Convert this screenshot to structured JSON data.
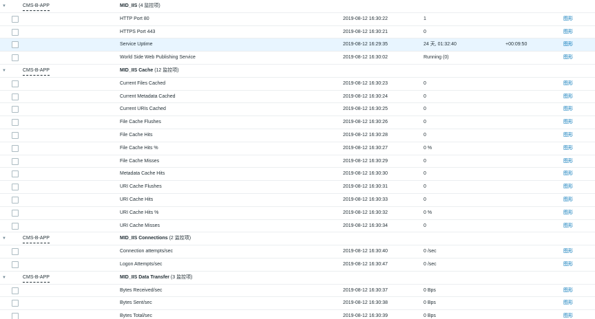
{
  "graph_link_label": "图形",
  "groups": [
    {
      "host": "CMS-B-APP",
      "app": "MID_IIS",
      "count": "(4 监控项)",
      "items": [
        {
          "name": "HTTP Port 80",
          "time": "2019-08-12 16:30:22",
          "value": "1",
          "change": ""
        },
        {
          "name": "HTTPS Port 443",
          "time": "2019-08-12 16:30:21",
          "value": "0",
          "change": ""
        },
        {
          "name": "Service Uptime",
          "time": "2019-08-12 16:29:35",
          "value": "24 天, 01:32:40",
          "change": "+00:09:50"
        },
        {
          "name": "World Side Web Publishing Service",
          "time": "2019-08-12 16:30:02",
          "value": "Running (0)",
          "change": ""
        }
      ]
    },
    {
      "host": "CMS-B-APP",
      "app": "MID_IIS Cache",
      "count": "(12 监控项)",
      "items": [
        {
          "name": "Current Files Cached",
          "time": "2019-08-12 16:30:23",
          "value": "0",
          "change": ""
        },
        {
          "name": "Current Metadata Cached",
          "time": "2019-08-12 16:30:24",
          "value": "0",
          "change": ""
        },
        {
          "name": "Current URIs Cached",
          "time": "2019-08-12 16:30:25",
          "value": "0",
          "change": ""
        },
        {
          "name": "File Cache Flushes",
          "time": "2019-08-12 16:30:26",
          "value": "0",
          "change": ""
        },
        {
          "name": "File Cache Hits",
          "time": "2019-08-12 16:30:28",
          "value": "0",
          "change": ""
        },
        {
          "name": "File Cache Hits %",
          "time": "2019-08-12 16:30:27",
          "value": "0 %",
          "change": ""
        },
        {
          "name": "File Cache Misses",
          "time": "2019-08-12 16:30:29",
          "value": "0",
          "change": ""
        },
        {
          "name": "Metadata Cache Hits",
          "time": "2019-08-12 16:30:30",
          "value": "0",
          "change": ""
        },
        {
          "name": "URI Cache Flushes",
          "time": "2019-08-12 16:30:31",
          "value": "0",
          "change": ""
        },
        {
          "name": "URI Cache Hits",
          "time": "2019-08-12 16:30:33",
          "value": "0",
          "change": ""
        },
        {
          "name": "URI Cache Hits %",
          "time": "2019-08-12 16:30:32",
          "value": "0 %",
          "change": ""
        },
        {
          "name": "URI Cache Misses",
          "time": "2019-08-12 16:30:34",
          "value": "0",
          "change": ""
        }
      ]
    },
    {
      "host": "CMS-B-APP",
      "app": "MID_IIS Connections",
      "count": "(2 监控项)",
      "items": [
        {
          "name": "Connection attempts/sec",
          "time": "2019-08-12 16:30:40",
          "value": "0 /sec",
          "change": ""
        },
        {
          "name": "Logon Attempts/sec",
          "time": "2019-08-12 16:30:47",
          "value": "0 /sec",
          "change": ""
        }
      ]
    },
    {
      "host": "CMS-B-APP",
      "app": "MID_IIS Data Transfer",
      "count": "(3 监控项)",
      "items": [
        {
          "name": "Bytes Received/sec",
          "time": "2019-08-12 16:30:37",
          "value": "0 Bps",
          "change": ""
        },
        {
          "name": "Bytes Sent/sec",
          "time": "2019-08-12 16:30:38",
          "value": "0 Bps",
          "change": ""
        },
        {
          "name": "Bytes Total/sec",
          "time": "2019-08-12 16:30:39",
          "value": "0 Bps",
          "change": ""
        }
      ]
    }
  ]
}
